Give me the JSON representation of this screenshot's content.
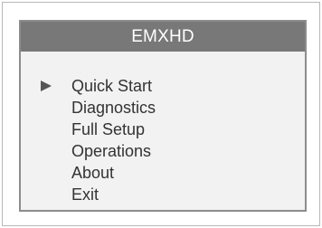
{
  "screen": {
    "title": "EMXHD"
  },
  "menu": {
    "selected_index": 0,
    "items": [
      {
        "label": "Quick Start"
      },
      {
        "label": "Diagnostics"
      },
      {
        "label": "Full Setup"
      },
      {
        "label": "Operations"
      },
      {
        "label": "About"
      },
      {
        "label": "Exit"
      }
    ]
  },
  "colors": {
    "title_bar": "#787878",
    "screen_bg": "#f2f2f2",
    "text": "#333333",
    "border": "#8c8c8c"
  },
  "icons": {
    "selection": "right-triangle-pointer"
  }
}
